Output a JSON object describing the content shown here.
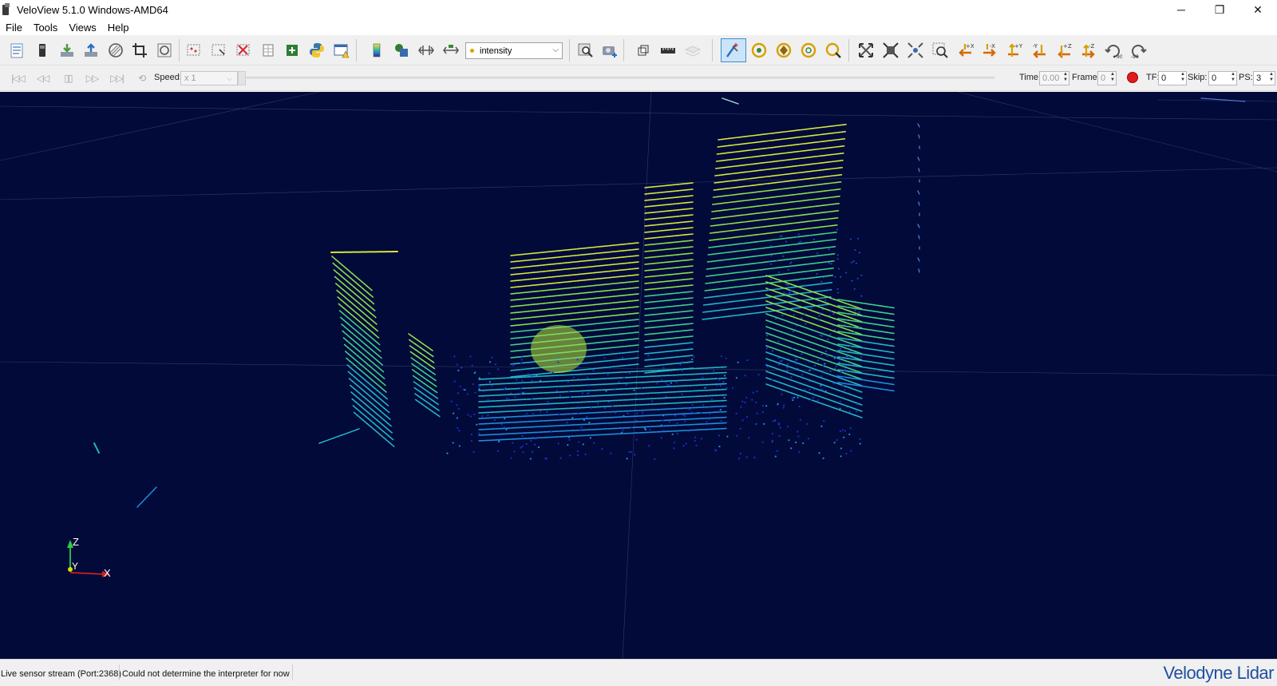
{
  "window": {
    "title": "VeloView 5.1.0 Windows-AMD64",
    "controls": [
      "─",
      "❐",
      "✕"
    ]
  },
  "menu": [
    "File",
    "Tools",
    "Views",
    "Help"
  ],
  "toolbar": {
    "color_by": "intensity"
  },
  "playback": {
    "speed_label": "Speed:",
    "speed_value": "x 1",
    "time_label": "Time",
    "time_value": "0.00",
    "frame_label": "Frame",
    "frame_value": "0",
    "tf_label": "TF:",
    "tf_value": "0",
    "skip_label": "Skip:",
    "skip_value": "0",
    "ps_label": "PS:",
    "ps_value": "3"
  },
  "axes": {
    "z": "Z",
    "y": "Y",
    "x": "X"
  },
  "status": {
    "stream": "Live sensor stream (Port:2368)",
    "message": "Could not determine the interpreter for now"
  },
  "brand": "Velodyne Lidar",
  "colors": {
    "viewport_bg": "#020a3a",
    "accent": "#1f4fa0",
    "record": "#e01b1b"
  }
}
